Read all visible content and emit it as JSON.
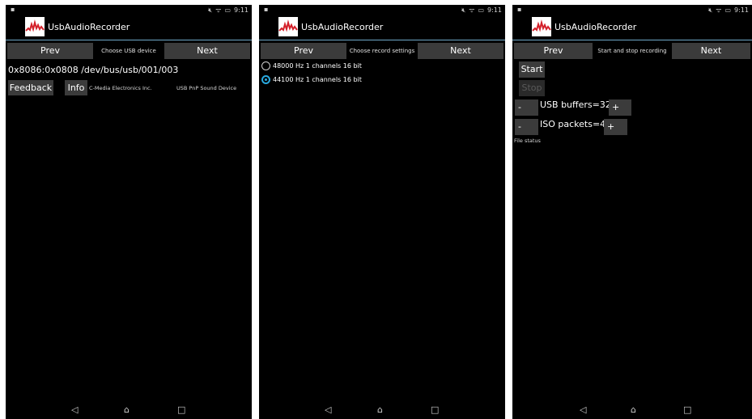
{
  "status": {
    "time": "9:11",
    "icons": [
      "mute-icon",
      "wifi-icon",
      "battery-icon"
    ]
  },
  "app": {
    "title": "UsbAudioRecorder"
  },
  "nav": {
    "prev_label": "Prev",
    "next_label": "Next"
  },
  "screen1": {
    "step_label": "Choose USB device",
    "device_line": "0x8086:0x0808 /dev/bus/usb/001/003",
    "feedback_label": "Feedback",
    "info_label": "Info",
    "manufacturer": "C-Media Electronics Inc.",
    "product": "USB PnP Sound Device"
  },
  "screen2": {
    "step_label": "Choose record settings",
    "options": [
      {
        "label": "48000 Hz 1 channels 16 bit",
        "selected": false
      },
      {
        "label": "44100 Hz 1 channels 16 bit",
        "selected": true
      }
    ]
  },
  "screen3": {
    "step_label": "Start and stop recording",
    "start_label": "Start",
    "stop_label": "Stop",
    "minus_label": "-",
    "plus_label": "+",
    "usb_buffers_label": "USB buffers=32",
    "iso_packets_label": "ISO packets=4",
    "file_status": "File status"
  },
  "sysnav": {
    "back": "◁",
    "home": "⌂",
    "recent": "□"
  },
  "colors": {
    "accent": "#29a9e0",
    "button": "#3b3b3b",
    "divider": "#6fa9c9",
    "background": "#000000"
  }
}
